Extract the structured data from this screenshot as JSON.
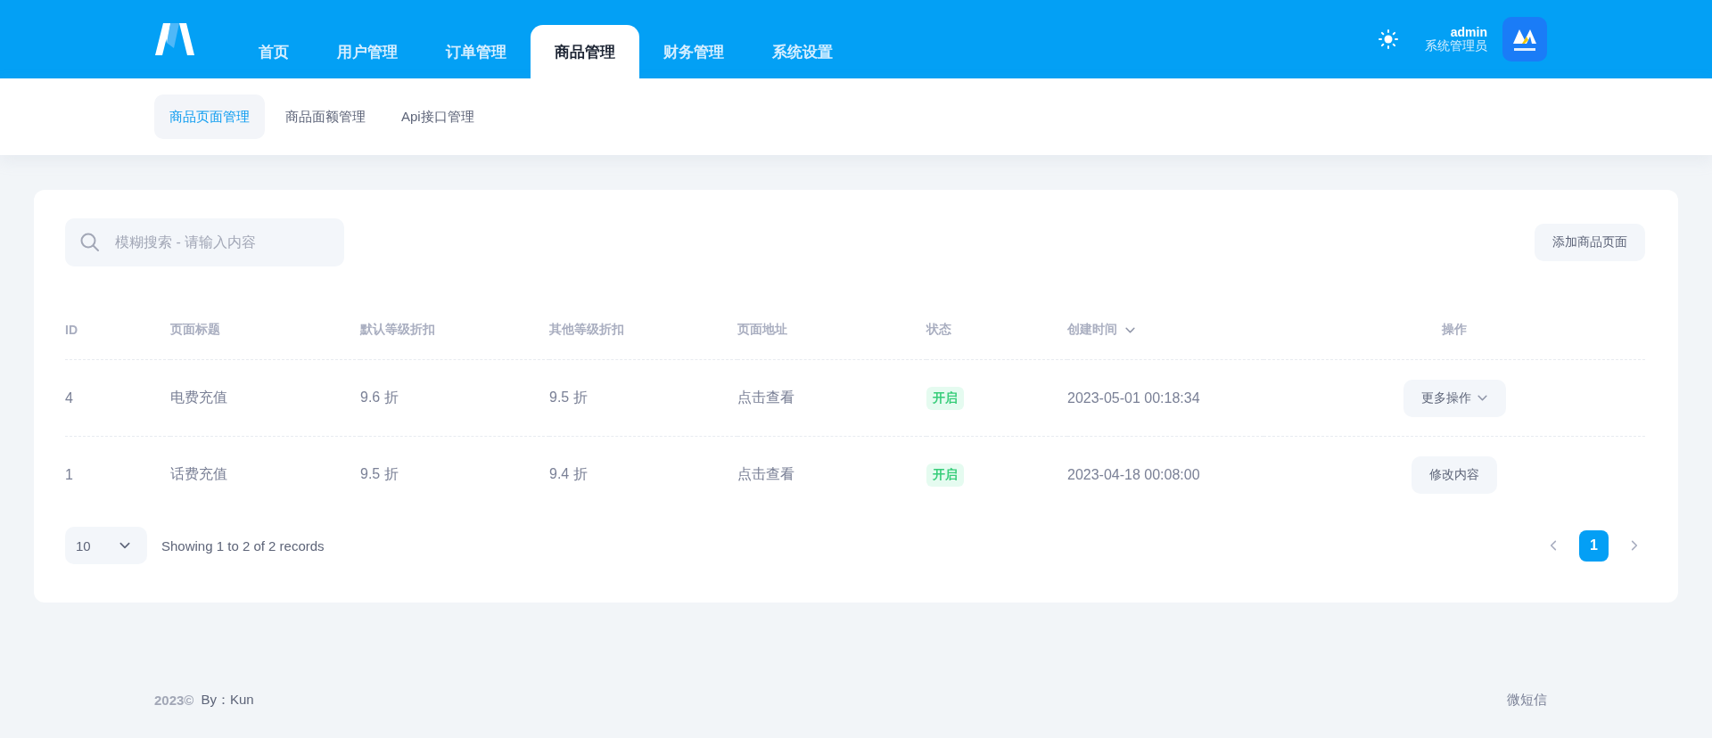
{
  "header": {
    "nav": [
      {
        "label": "首页",
        "selected": false
      },
      {
        "label": "用户管理",
        "selected": false
      },
      {
        "label": "订单管理",
        "selected": false
      },
      {
        "label": "商品管理",
        "selected": true
      },
      {
        "label": "财务管理",
        "selected": false
      },
      {
        "label": "系统设置",
        "selected": false
      }
    ],
    "user": {
      "name": "admin",
      "role": "系统管理员"
    }
  },
  "subnav": [
    {
      "label": "商品页面管理",
      "selected": true
    },
    {
      "label": "商品面额管理",
      "selected": false
    },
    {
      "label": "Api接口管理",
      "selected": false
    }
  ],
  "search": {
    "placeholder": "模糊搜索 - 请输入内容"
  },
  "add_button": "添加商品页面",
  "table": {
    "columns": [
      {
        "label": "ID",
        "sortable": false
      },
      {
        "label": "页面标题",
        "sortable": false
      },
      {
        "label": "默认等级折扣",
        "sortable": false
      },
      {
        "label": "其他等级折扣",
        "sortable": false
      },
      {
        "label": "页面地址",
        "sortable": false
      },
      {
        "label": "状态",
        "sortable": false
      },
      {
        "label": "创建时间",
        "sortable": true
      },
      {
        "label": "操作",
        "sortable": false
      }
    ],
    "rows": [
      {
        "id": "4",
        "title": "电费充值",
        "default_discount": "9.6 折",
        "other_discount": "9.5 折",
        "page_link": "点击查看",
        "status": {
          "label": "开启",
          "enabled": true
        },
        "created": "2023-05-01 00:18:34",
        "action": {
          "kind": "dropdown",
          "label": "更多操作"
        }
      },
      {
        "id": "1",
        "title": "话费充值",
        "default_discount": "9.5 折",
        "other_discount": "9.4 折",
        "page_link": "点击查看",
        "status": {
          "label": "开启",
          "enabled": true
        },
        "created": "2023-04-18 00:08:00",
        "action": {
          "kind": "button",
          "label": "修改内容"
        }
      }
    ]
  },
  "pagination": {
    "page_size": "10",
    "summary": "Showing 1 to 2 of 2 records",
    "pages": [
      {
        "label": "1",
        "selected": true
      }
    ]
  },
  "footer": {
    "year": "2023©",
    "author": "By：Kun",
    "right": "微短信"
  }
}
